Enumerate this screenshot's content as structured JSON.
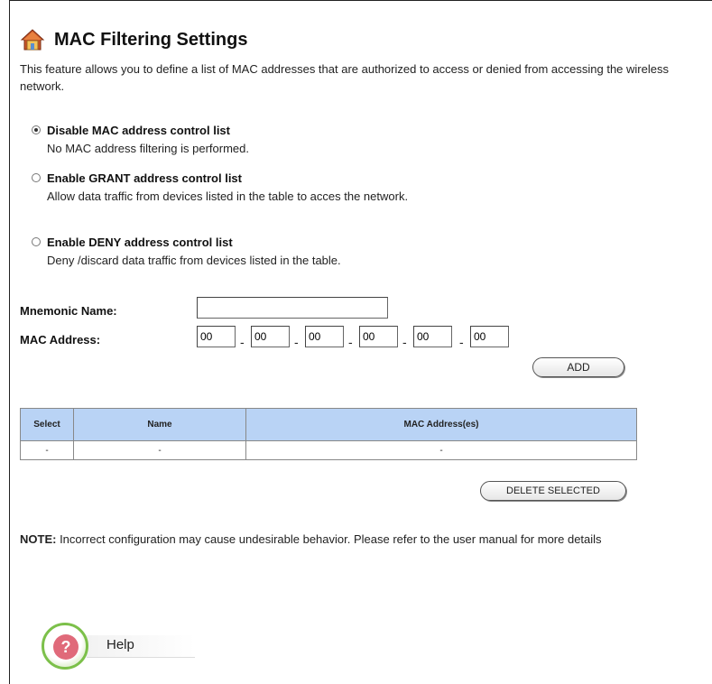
{
  "header": {
    "title": "MAC Filtering Settings",
    "description": "This feature allows you to define a list of MAC addresses that are authorized to access or denied from accessing the wireless network."
  },
  "options": [
    {
      "label": "Disable MAC address control list",
      "description": "No MAC address filtering is performed.",
      "checked": true
    },
    {
      "label": "Enable GRANT address control list",
      "description": "Allow data traffic from devices listed in the table to acces the network.",
      "checked": false
    },
    {
      "label": "Enable DENY address control list",
      "description": "Deny /discard data traffic from devices listed in the table.",
      "checked": false
    }
  ],
  "form": {
    "mnemonic_label": "Mnemonic Name:",
    "mnemonic_value": "",
    "mac_label": "MAC Address:",
    "mac_octets": [
      "00",
      "00",
      "00",
      "00",
      "00",
      "00"
    ],
    "separator": "-",
    "add_button": "ADD"
  },
  "table": {
    "headers": [
      "Select",
      "Name",
      "MAC Address(es)"
    ],
    "rows": [
      [
        "-",
        "-",
        "-"
      ]
    ]
  },
  "delete_button": "DELETE SELECTED",
  "note": {
    "bold": "NOTE:",
    "text": " Incorrect configuration may cause undesirable behavior. Please refer to the user manual for more details"
  },
  "help": {
    "label": "Help",
    "icon": "help-icon"
  },
  "colors": {
    "table_header": "#b9d3f5",
    "help_ring": "#7cc04a",
    "help_badge": "#e06a7a"
  }
}
